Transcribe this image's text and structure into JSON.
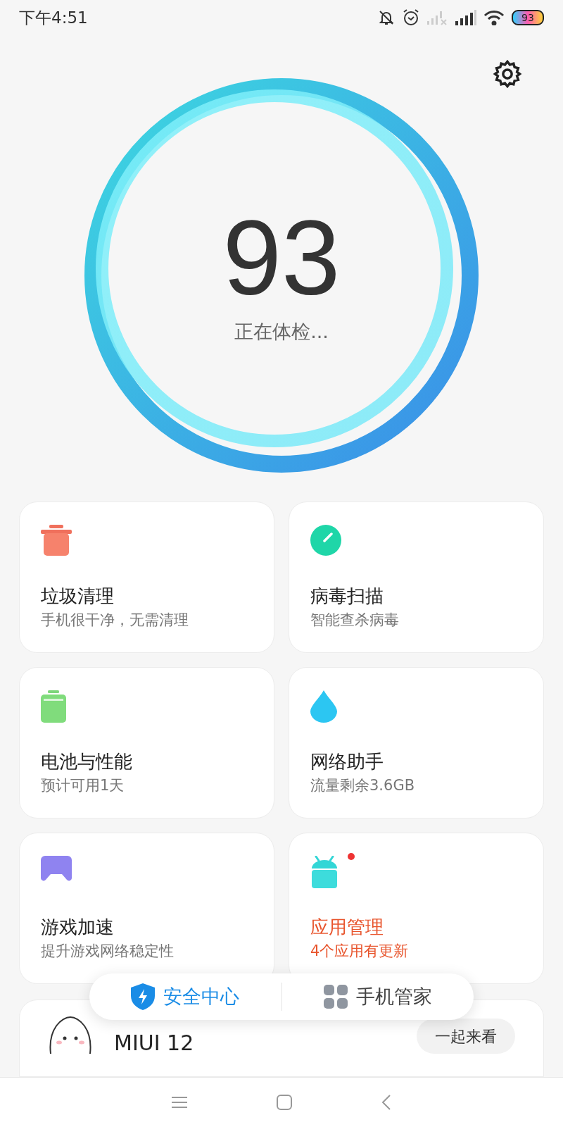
{
  "status_bar": {
    "time": "下午4:51",
    "battery": "93"
  },
  "score": {
    "value": "93",
    "caption": "正在体检..."
  },
  "cards": [
    {
      "kind": "trash",
      "title": "垃圾清理",
      "subtitle": "手机很干净，无需清理",
      "alert": false
    },
    {
      "kind": "scan",
      "title": "病毒扫描",
      "subtitle": "智能查杀病毒",
      "alert": false
    },
    {
      "kind": "battery",
      "title": "电池与性能",
      "subtitle": "预计可用1天",
      "alert": false
    },
    {
      "kind": "drop",
      "title": "网络助手",
      "subtitle": "流量剩余3.6GB",
      "alert": false
    },
    {
      "kind": "game",
      "title": "游戏加速",
      "subtitle": "提升游戏网络稳定性",
      "alert": false
    },
    {
      "kind": "android",
      "title": "应用管理",
      "subtitle": "4个应用有更新",
      "alert": true
    }
  ],
  "promo": {
    "title": "MIUI 12",
    "button": "一起来看"
  },
  "bottom_tabs": [
    {
      "kind": "shield",
      "label": "安全中心",
      "selected": true
    },
    {
      "kind": "grid",
      "label": "手机管家",
      "selected": false
    }
  ]
}
